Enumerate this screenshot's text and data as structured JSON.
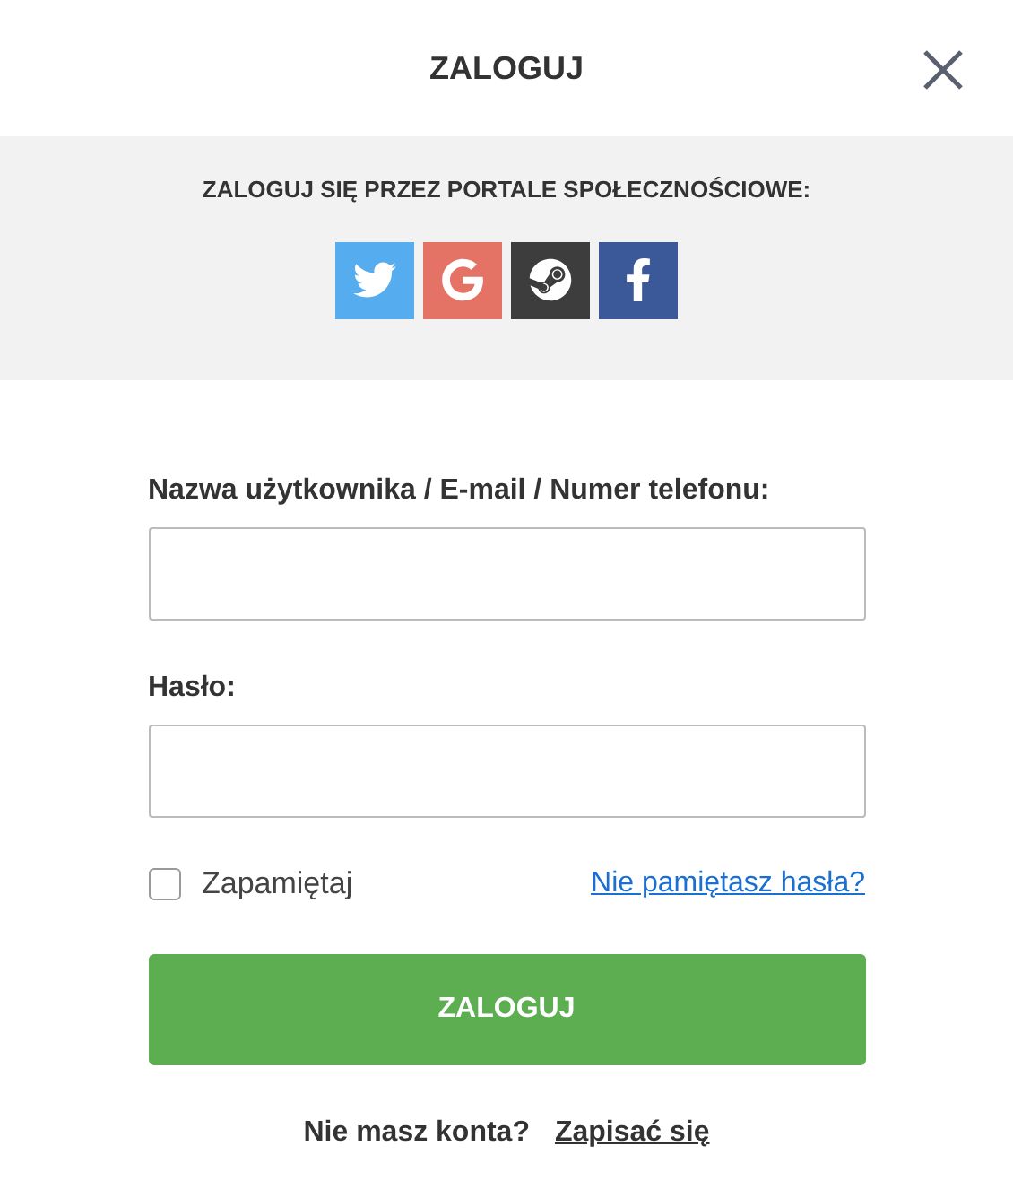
{
  "dialog": {
    "title": "ZALOGUJ"
  },
  "social": {
    "heading": "ZALOGUJ SIĘ PRZEZ PORTALE SPOŁECZNOŚCIOWE:",
    "buttons": [
      {
        "kind": "bird",
        "color": "#55acee"
      },
      {
        "kind": "g",
        "color": "#e57365"
      },
      {
        "kind": "steam",
        "color": "#3d3d3d"
      },
      {
        "kind": "f",
        "color": "#3b5998"
      }
    ]
  },
  "form": {
    "username_label": "Nazwa użytkownika / E-mail / Numer telefonu:",
    "password_label": "Hasło:",
    "remember": {
      "label": "Zapamiętaj",
      "checked": false
    },
    "forgot_link": "Nie pamiętasz hasła?",
    "submit": "ZALOGUJ"
  },
  "footer": {
    "question": "Nie masz konta?",
    "signup_link": "Zapisać się"
  }
}
